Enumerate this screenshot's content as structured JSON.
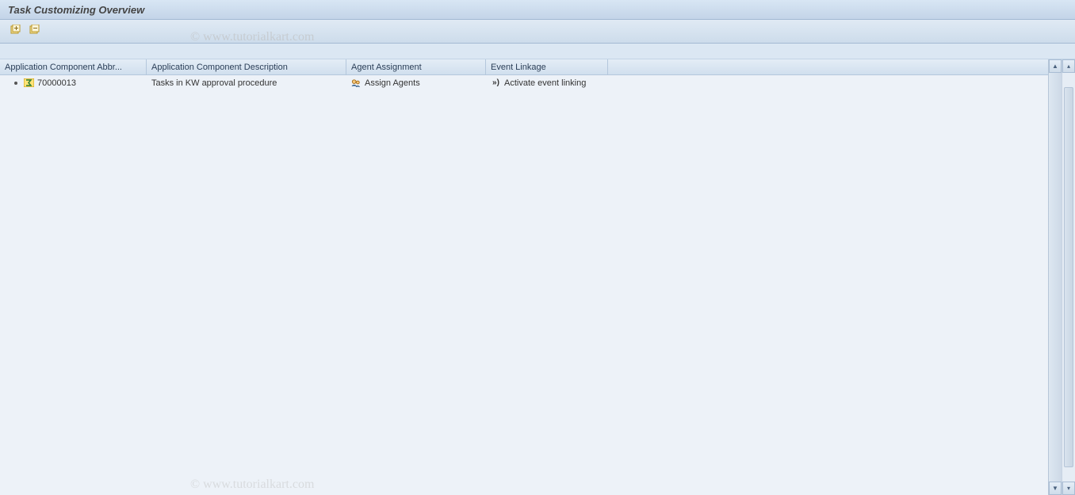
{
  "header": {
    "title": "Task Customizing Overview"
  },
  "table": {
    "columns": {
      "abbr": "Application Component Abbr...",
      "desc": "Application Component Description",
      "agent": "Agent Assignment",
      "event": "Event Linkage"
    },
    "rows": [
      {
        "abbr": "70000013",
        "desc": "Tasks in KW approval procedure",
        "agent": "Assign Agents",
        "event": "Activate event linking"
      }
    ]
  },
  "watermark": "© www.tutorialkart.com"
}
